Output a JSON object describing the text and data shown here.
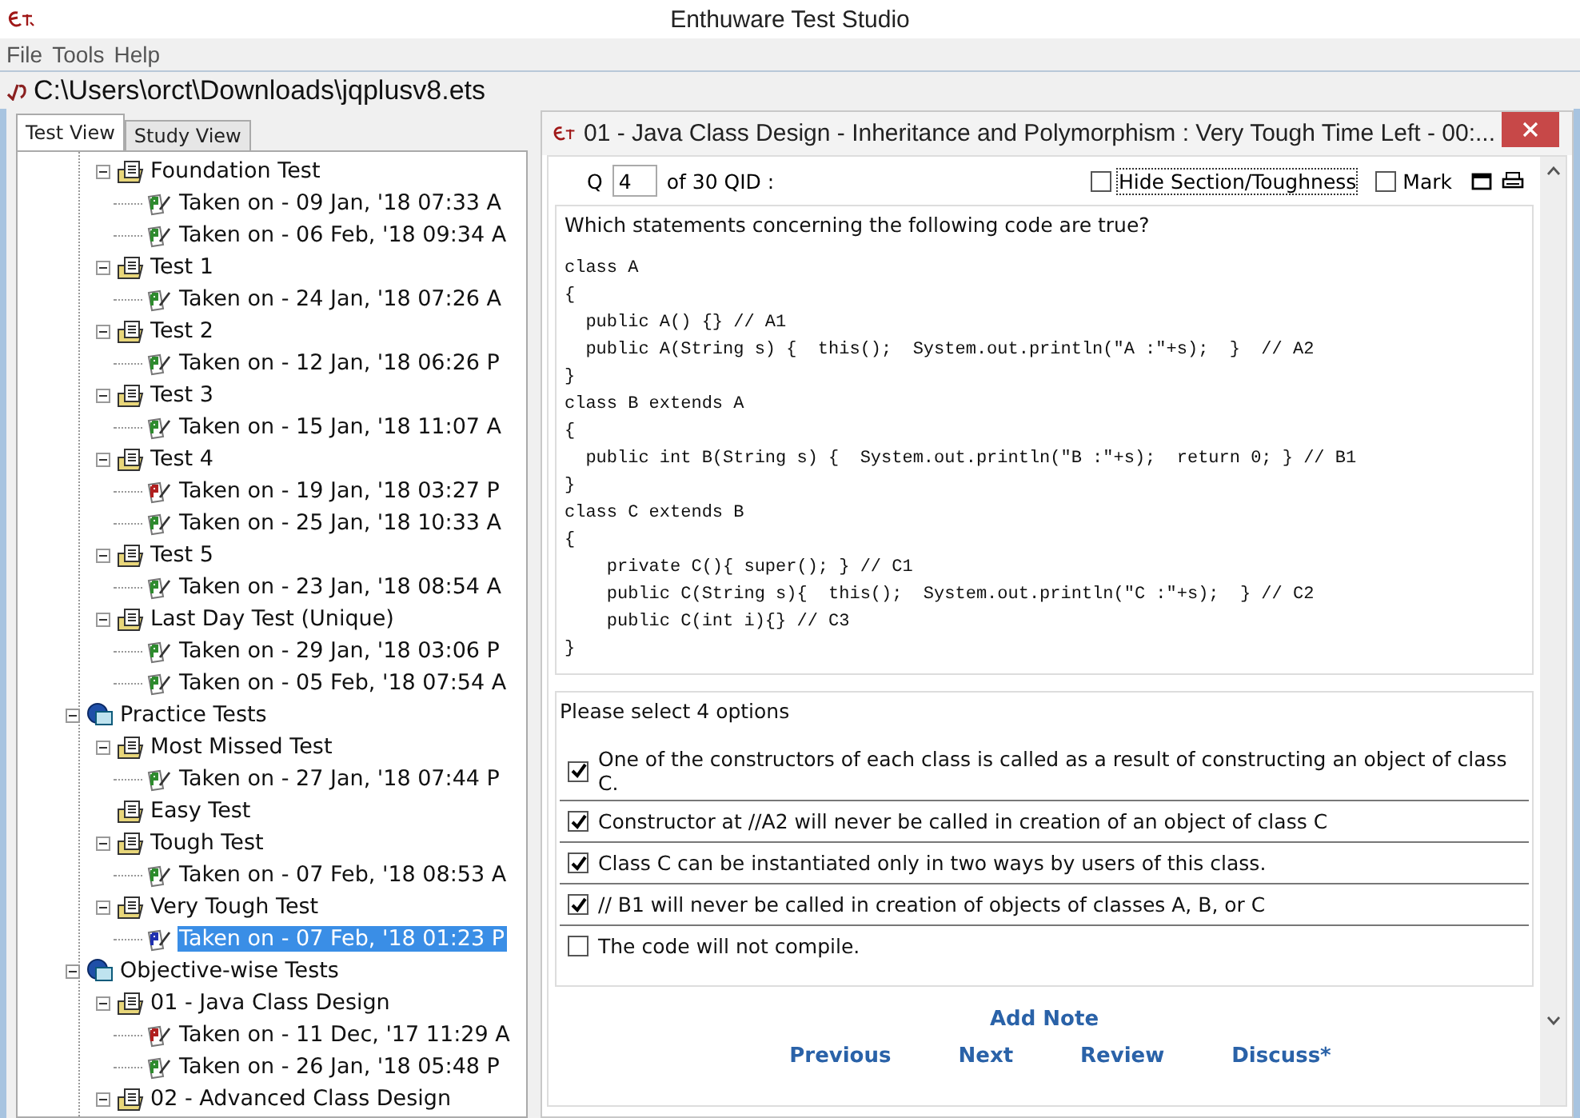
{
  "window": {
    "title": "Enthuware Test Studio"
  },
  "menu": [
    "File",
    "Tools",
    "Help"
  ],
  "path": "C:\\Users\\orct\\Downloads\\jqplusv8.ets",
  "tabs": [
    {
      "label": "Test View",
      "selected": true
    },
    {
      "label": "Study View",
      "selected": false
    }
  ],
  "tree": [
    {
      "kind": "test",
      "label": "Foundation Test",
      "expanded": true,
      "children": [
        {
          "kind": "attempt",
          "color": "#2e8b2e",
          "label": "Taken on - 09 Jan, '18 07:33 A",
          "selected": false
        },
        {
          "kind": "attempt",
          "color": "#2e8b2e",
          "label": "Taken on - 06 Feb, '18 09:34 A",
          "selected": false
        }
      ]
    },
    {
      "kind": "test",
      "label": "Test 1",
      "expanded": true,
      "children": [
        {
          "kind": "attempt",
          "color": "#2e8b2e",
          "label": "Taken on - 24 Jan, '18 07:26 A",
          "selected": false
        }
      ]
    },
    {
      "kind": "test",
      "label": "Test 2",
      "expanded": true,
      "children": [
        {
          "kind": "attempt",
          "color": "#2e8b2e",
          "label": "Taken on - 12 Jan, '18 06:26 P",
          "selected": false
        }
      ]
    },
    {
      "kind": "test",
      "label": "Test 3",
      "expanded": true,
      "children": [
        {
          "kind": "attempt",
          "color": "#2e8b2e",
          "label": "Taken on - 15 Jan, '18 11:07 A",
          "selected": false
        }
      ]
    },
    {
      "kind": "test",
      "label": "Test 4",
      "expanded": true,
      "children": [
        {
          "kind": "attempt",
          "color": "#b02020",
          "label": "Taken on - 19 Jan, '18 03:27 P",
          "selected": false
        },
        {
          "kind": "attempt",
          "color": "#2e8b2e",
          "label": "Taken on - 25 Jan, '18 10:33 A",
          "selected": false
        }
      ]
    },
    {
      "kind": "test",
      "label": "Test 5",
      "expanded": true,
      "children": [
        {
          "kind": "attempt",
          "color": "#2e8b2e",
          "label": "Taken on - 23 Jan, '18 08:54 A",
          "selected": false
        }
      ]
    },
    {
      "kind": "test",
      "label": "Last Day Test (Unique)",
      "expanded": true,
      "children": [
        {
          "kind": "attempt",
          "color": "#2e8b2e",
          "label": "Taken on - 29 Jan, '18 03:06 P",
          "selected": false
        },
        {
          "kind": "attempt",
          "color": "#2e8b2e",
          "label": "Taken on - 05 Feb, '18 07:54 A",
          "selected": false
        }
      ]
    },
    {
      "kind": "category",
      "label": "Practice Tests",
      "expanded": true,
      "children": [
        {
          "kind": "test",
          "label": "Most Missed Test",
          "expanded": true,
          "children": [
            {
              "kind": "attempt",
              "color": "#2e8b2e",
              "label": "Taken on - 27 Jan, '18 07:44 P",
              "selected": false
            }
          ]
        },
        {
          "kind": "test",
          "label": "Easy Test"
        },
        {
          "kind": "test",
          "label": "Tough Test",
          "expanded": true,
          "children": [
            {
              "kind": "attempt",
              "color": "#2e8b2e",
              "label": "Taken on - 07 Feb, '18 08:53 A",
              "selected": false
            }
          ]
        },
        {
          "kind": "test",
          "label": "Very Tough Test",
          "expanded": true,
          "children": [
            {
              "kind": "attempt",
              "color": "#2030b0",
              "label": "Taken on - 07 Feb, '18 01:23 P",
              "selected": true
            }
          ]
        }
      ]
    },
    {
      "kind": "category",
      "label": "Objective-wise Tests",
      "expanded": true,
      "children": [
        {
          "kind": "test",
          "label": "01 - Java Class Design",
          "expanded": true,
          "children": [
            {
              "kind": "attempt",
              "color": "#b02020",
              "label": "Taken on - 11 Dec, '17 11:29 A",
              "selected": false
            },
            {
              "kind": "attempt",
              "color": "#2e8b2e",
              "label": "Taken on - 26 Jan, '18 05:48 P",
              "selected": false
            }
          ]
        },
        {
          "kind": "test",
          "label": "02 - Advanced Class Design",
          "expanded": true
        }
      ]
    }
  ],
  "dialog": {
    "title": "01 - Java Class Design - Inheritance and Polymorphism  :  Very Tough   Time Left - 00:...",
    "q_label": "Q",
    "q_number": "4",
    "q_total": "of 30 QID :",
    "hide_section": {
      "label": "Hide Section/Toughness",
      "checked": false
    },
    "mark": {
      "label": "Mark",
      "checked": false
    },
    "prompt": "Which statements concerning the following code are true?",
    "code": [
      "class A",
      "{",
      "  public A() {} // A1",
      "  public A(String s) {  this();  System.out.println(\"A :\"+s);  }  // A2",
      "}",
      "class B extends A",
      "{",
      "  public int B(String s) {  System.out.println(\"B :\"+s);  return 0; } // B1",
      "}",
      "class C extends B",
      "{",
      "    private C(){ super(); } // C1",
      "    public C(String s){  this();  System.out.println(\"C :\"+s);  } // C2",
      "    public C(int i){} // C3",
      "}"
    ],
    "instruction": "Please select 4 options",
    "options": [
      {
        "label": "One of the constructors of each class is called as a result of constructing an object of class C.",
        "checked": true
      },
      {
        "label": "Constructor at  //A2 will never be called in creation of an object of class C",
        "checked": true
      },
      {
        "label": "Class C can be instantiated only in two ways by users of this class.",
        "checked": true
      },
      {
        "label": "// B1 will never be called in creation of objects of classes A, B, or C",
        "checked": true
      },
      {
        "label": "The code will not compile.",
        "checked": false
      }
    ],
    "add_note": "Add Note",
    "nav": [
      "Previous",
      "Next",
      "Review",
      "Discuss*"
    ]
  }
}
